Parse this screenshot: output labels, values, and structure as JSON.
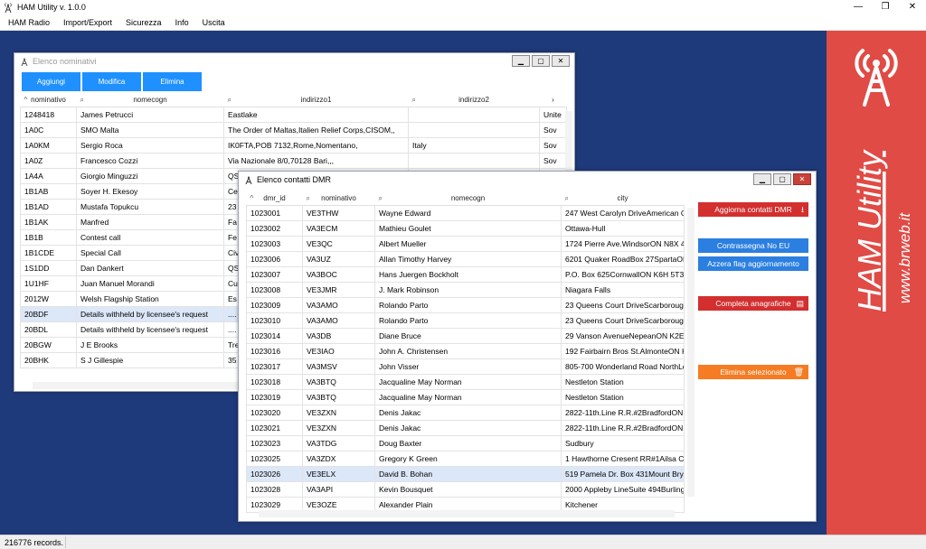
{
  "app": {
    "title": "HAM Utility v. 1.0.0",
    "controls": [
      "—",
      "❐",
      "✕"
    ]
  },
  "menu": [
    "HAM Radio",
    "Import/Export",
    "Sicurezza",
    "Info",
    "Uscita"
  ],
  "status": {
    "records": "216776 records."
  },
  "brand": {
    "name": "HAM Utility",
    "site": "www.brweb.it"
  },
  "nominativi": {
    "title": "Elenco nominativi",
    "buttons": {
      "add": "Aggiungi",
      "edit": "Modifica",
      "delete": "Elimina"
    },
    "columns": [
      "nominativo",
      "nomecogn",
      "indirizzo1",
      "indirizzo2",
      ""
    ],
    "rows": [
      [
        "1248418",
        "James Petrucci",
        "Eastlake",
        "",
        "Unite"
      ],
      [
        "1A0C",
        "SMO Malta",
        "The Order of Maltas,Italien Relief Corps,CISOM,,",
        "",
        "Sov"
      ],
      [
        "1A0KM",
        "Sergio Roca",
        "IK0FTA,POB 7132,Rome,Nomentano,",
        "Italy",
        "Sov"
      ],
      [
        "1A0Z",
        "Francesco Cozzi",
        "Via Nazionale 8/0,70128 Bari,,,",
        "",
        "Sov"
      ],
      [
        "1A4A",
        "Giorgio Minguzzi",
        "QS",
        "",
        ""
      ],
      [
        "1B1AB",
        "Soyer H. Ekesoy",
        "Ce",
        "",
        ""
      ],
      [
        "1B1AD",
        "Mustafa Topukcu",
        "23",
        "",
        ""
      ],
      [
        "1B1AK",
        "Manfred",
        "Fa",
        "",
        ""
      ],
      [
        "1B1B",
        "Contest call",
        "Fe",
        "",
        ""
      ],
      [
        "1B1CDE",
        "Special Call",
        "Civ",
        "",
        ""
      ],
      [
        "1S1DD",
        "Dan Dankert",
        "QS",
        "",
        ""
      ],
      [
        "1U1HF",
        "Juan Manuel Morandi",
        "Cu",
        "",
        ""
      ],
      [
        "2012W",
        "Welsh Flagship Station",
        "Es",
        "",
        ""
      ],
      [
        "20BDF",
        "Details withheld by licensee's request",
        "....",
        "",
        ""
      ],
      [
        "20BDL",
        "Details withheld by licensee's request",
        "....",
        "",
        ""
      ],
      [
        "20BGW",
        "J E Brooks",
        "Tre",
        "",
        ""
      ],
      [
        "20BHK",
        "S J Gillespie",
        "35",
        "",
        ""
      ]
    ]
  },
  "dmr": {
    "title": "Elenco contatti DMR",
    "columns": [
      "dmr_id",
      "nominativo",
      "nomecogn",
      "city"
    ],
    "rows": [
      [
        "1023001",
        "VE3THW",
        "Wayne Edward",
        "247 West Carolyn DriveAmerican Canyon"
      ],
      [
        "1023002",
        "VA3ECM",
        "Mathieu Goulet",
        "Ottawa-Hull"
      ],
      [
        "1023003",
        "VE3QC",
        "Albert Mueller",
        "1724 Pierre Ave.WindsorON N8X 4P8"
      ],
      [
        "1023006",
        "VA3UZ",
        "Allan Timothy Harvey",
        "6201 Quaker RoadBox 27SpartaON N0L 2"
      ],
      [
        "1023007",
        "VA3BOC",
        "Hans Juergen Bockholt",
        "P.O. Box 625CornwallON K6H 5T3"
      ],
      [
        "1023008",
        "VE3JMR",
        "J. Mark Robinson",
        "Niagara Falls"
      ],
      [
        "1023009",
        "VA3AMO",
        "Rolando Parto",
        "23 Queens Court DriveScarboroughON M1"
      ],
      [
        "1023010",
        "VA3AMO",
        "Rolando Parto",
        "23 Queens Court DriveScarboroughON M1"
      ],
      [
        "1023014",
        "VA3DB",
        "Diane Bruce",
        "29 Vanson AvenueNepeanON K2E 6A9"
      ],
      [
        "1023016",
        "VE3IAO",
        "John A. Christensen",
        "192 Fairbairn Bros St.AlmonteON K0A 1A0"
      ],
      [
        "1023017",
        "VA3MSV",
        "John Visser",
        "805-700 Wonderland Road NorthLondonON"
      ],
      [
        "1023018",
        "VA3BTQ",
        "Jacqualine May Norman",
        "Nestleton Station"
      ],
      [
        "1023019",
        "VA3BTQ",
        "Jacqualine May Norman",
        "Nestleton Station"
      ],
      [
        "1023020",
        "VE3ZXN",
        "Denis Jakac",
        "2822-11th.Line R.R.#2BradfordON L3Z 2A5"
      ],
      [
        "1023021",
        "VE3ZXN",
        "Denis Jakac",
        "2822-11th.Line R.R.#2BradfordON L3Z 2A5"
      ],
      [
        "1023023",
        "VA3TDG",
        "Doug Baxter",
        "Sudbury"
      ],
      [
        "1023025",
        "VA3ZDX",
        "Gregory K Green",
        "1 Hawthorne Cresent RR#1Ailsa CraigON"
      ],
      [
        "1023026",
        "VE3ELX",
        "David B. Bohan",
        "519 Pamela Dr. Box 431Mount BrydgesON"
      ],
      [
        "1023028",
        "VA3API",
        "Kevin Bousquet",
        "2000 Appleby LineSuite 494BurlingtonON"
      ],
      [
        "1023029",
        "VE3OZE",
        "Alexander Plain",
        "Kitchener"
      ]
    ],
    "actions": {
      "update": "Aggiorna contatti DMR",
      "mark": "Contrassegna No EU",
      "reset": "Azzera flag aggiornamento",
      "complete": "Completa anagrafiche",
      "delete": "Elimina selezionato"
    }
  },
  "colors": {
    "desktop": "#1f3a7a",
    "brand": "#e04b45",
    "primary_button": "#1e90ff",
    "red_button": "#d32f2f",
    "blue_button": "#2b7fe0",
    "orange_button": "#f57c22",
    "selected_row": "#dce7f8"
  }
}
